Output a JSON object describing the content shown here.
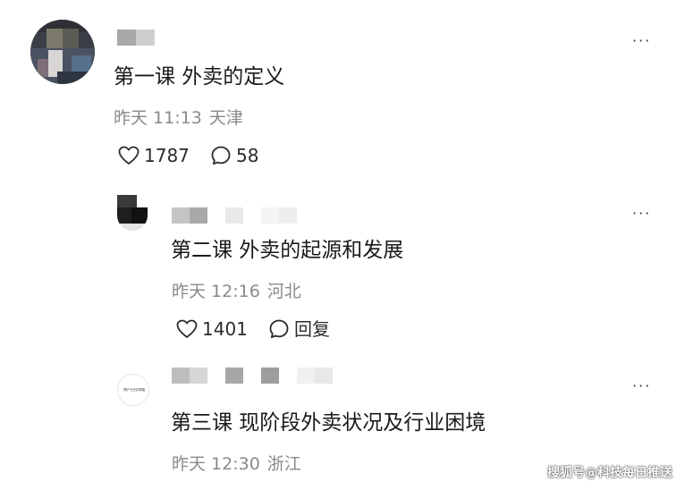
{
  "comments": [
    {
      "text": "第一课 外卖的定义",
      "time": "昨天 11:13",
      "location": "天津",
      "likes": "1787",
      "replies": "58",
      "more": "···"
    },
    {
      "text": "第二课 外卖的起源和发展",
      "time": "昨天 12:16",
      "location": "河北",
      "likes": "1401",
      "reply_label": "回复",
      "more": "···"
    },
    {
      "text": "第三课 现阶段外卖状况及行业困境",
      "time": "昨天 12:30",
      "location": "浙江",
      "more": "···",
      "avatar_text": "南户召拉哥帽"
    }
  ],
  "watermark": "搜狐号@科技每日推送",
  "colors": {
    "text": "#1a1a1a",
    "meta": "#8a8a8a",
    "icon": "#2b2b2b",
    "background": "#ffffff"
  },
  "icons": {
    "like": "heart-icon",
    "reply": "comment-bubble-icon",
    "more": "more-dots-icon"
  }
}
